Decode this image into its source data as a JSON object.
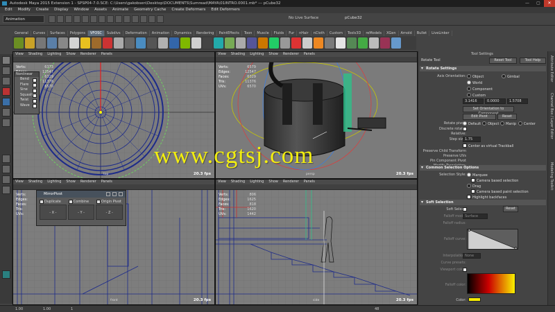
{
  "window": {
    "title": "Autodesk Maya 2015 Extension 1 - SPSP04-7.0.SCE: C:\\Users\\gakobsen\\Desktop\\DOCUMENTS\\Sumread\\MAYA\\01INTRO.0001.mb* --- pCube32",
    "minimize": "—",
    "maximize": "▢",
    "close": "✕"
  },
  "menu": [
    "Edit",
    "Modify",
    "Create",
    "Display",
    "Window",
    "Assets",
    "Animate",
    "Geometry Cache",
    "Create Deformers",
    "Edit Deformers"
  ],
  "status_line": {
    "mode": "Animation",
    "live_surface": "No Live Surface",
    "object_name": "pCube32"
  },
  "shelf_tabs": [
    "General",
    "Curves",
    "Surfaces",
    "Polygons",
    "Subdivs",
    "Deformation",
    "Animation",
    "Dynamics",
    "Rendering",
    "PaintEffects",
    "Toon",
    "Muscle",
    "Fluids",
    "Fur",
    "nHair",
    "nCloth",
    "Custom",
    "Tools3D",
    "reModels",
    "XGen",
    "Arnold",
    "Bullet",
    "LiveLinker",
    "Lighting",
    "GridTools"
  ],
  "shelf_active": "VFOSC",
  "viewport_menu": [
    "View",
    "Shading",
    "Lighting",
    "Show",
    "Renderer",
    "Panels"
  ],
  "hud": {
    "labels": [
      "Verts:",
      "Edges:",
      "Faces:",
      "Tris:",
      "UVs:"
    ],
    "top_left": [
      "6373",
      "12547",
      "6329",
      "11376",
      "6570"
    ],
    "top_right": [
      "6579",
      "12547",
      "6329",
      "11376",
      "6570"
    ],
    "bottom_left": [
      "806",
      "1625",
      "818",
      "1620",
      "1442"
    ],
    "bottom_right": [
      "806",
      "1625",
      "818",
      "1620",
      "1442"
    ]
  },
  "fps": "20.3 fps",
  "viewport_names": {
    "top_left": "top",
    "top_right": "persp",
    "bottom_left": "front",
    "bottom_right": "side"
  },
  "watermark": "www.cgtsj.com",
  "nonlinear": {
    "title": "Nonlinear",
    "items": [
      "Bend",
      "Flare",
      "Sine",
      "Squash",
      "Twist",
      "Wave"
    ]
  },
  "mirror_pivot": {
    "title": "MirrorPivot",
    "options": [
      "Duplicate",
      "Combine",
      "Origin Pivot"
    ],
    "axes": [
      "- X -",
      "- Y -",
      "- Z -"
    ]
  },
  "tool_settings": {
    "header": "Tool Settings",
    "tool_name": "Rotate Tool",
    "reset_tool": "Reset Tool",
    "tool_help": "Tool Help",
    "rotate_settings": {
      "title": "Rotate Settings",
      "axis_orientation_label": "Axis Orientation:",
      "axis_options": [
        "Object",
        "Gimbal",
        "World",
        "Component",
        "Custom"
      ],
      "selected_axis": "World",
      "custom_values": [
        "3.1416",
        "0.0000",
        "1.5708"
      ],
      "set_orientation": "Set Orientation to Component",
      "edit_pivot": "Edit Pivot",
      "reset": "Reset",
      "rotate_pivot_label": "Rotate pivot:",
      "pivot_options": [
        "Default",
        "Object",
        "Manip",
        "Center"
      ],
      "discrete_rotate": "Discrete rotate:",
      "relative": "Relative:",
      "step_size_label": "Step size:",
      "step_size": "1.75",
      "trackball": "Center as virtual Trackball",
      "preserve_child": "Preserve Child Transform",
      "preserve_uvs": "Preserve UVs",
      "pin_component": "Pin Component Pivot",
      "modify_translation": "Modify Translation:"
    },
    "common_selection": {
      "title": "Common Selection Options",
      "selection_style_label": "Selection Style:",
      "options": [
        "Marquee",
        "Camera based selection",
        "Drag",
        "Camera based paint selection",
        "Highlight backfaces"
      ]
    },
    "soft_selection": {
      "title": "Soft Selection",
      "soft_select_label": "Soft Select:",
      "reset": "Reset",
      "falloff_mode_label": "Falloff mode:",
      "falloff_mode": "Surface",
      "falloff_radius_label": "Falloff radius:",
      "falloff_curve_label": "Falloff curve:",
      "interpolation_label": "Interpolation:",
      "interpolation": "None",
      "curve_presets_label": "Curve presets:",
      "viewport_color_label": "Viewport color:",
      "falloff_color_label": "Falloff color:",
      "color_label": "Color:"
    }
  },
  "side_tabs": [
    "Attribute Editor",
    "Channel Box / Layer Editor",
    "Modeling Toolkit"
  ],
  "timeline": [
    "1.00",
    "1.00",
    "1",
    "48"
  ]
}
